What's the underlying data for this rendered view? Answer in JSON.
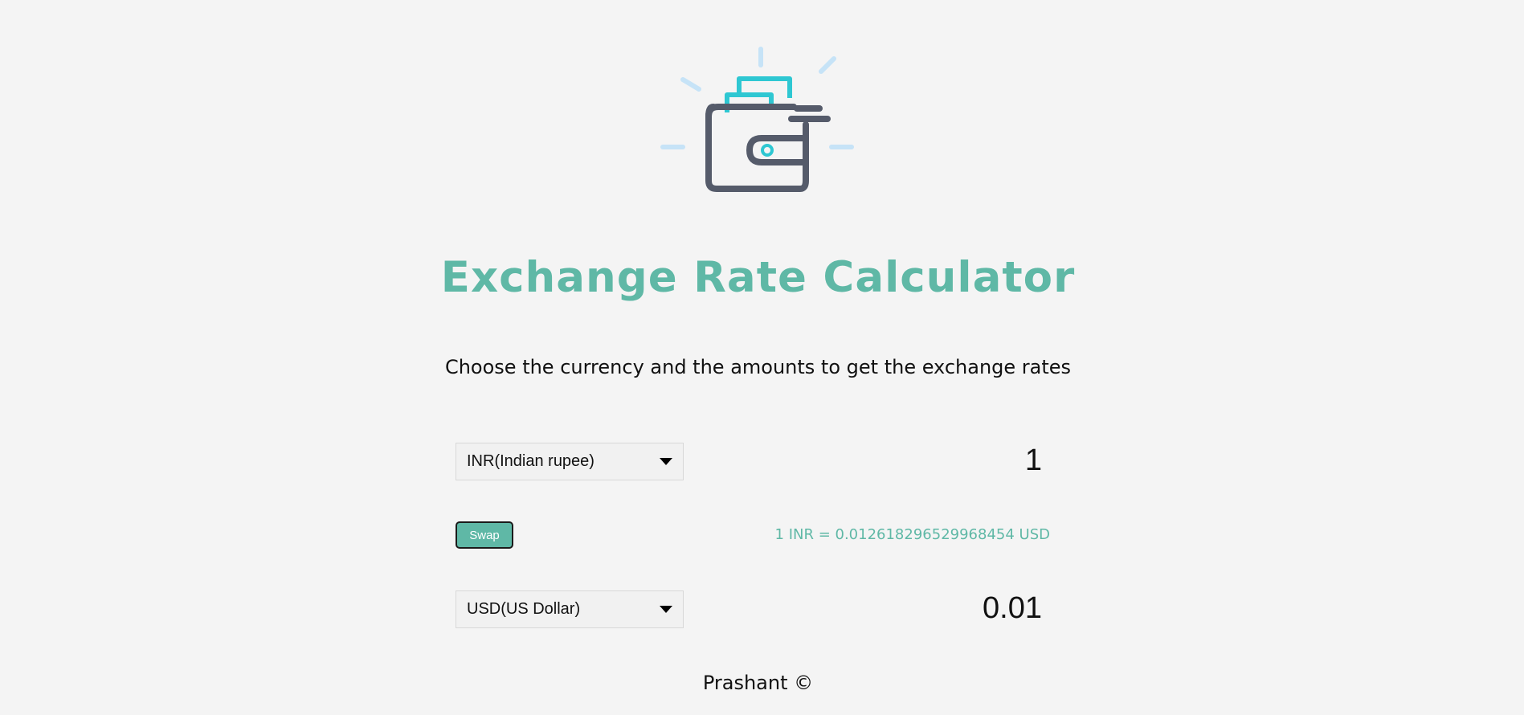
{
  "app": {
    "title": "Exchange Rate Calculator",
    "subtitle": "Choose the currency and the amounts to get the exchange rates"
  },
  "logo": {
    "icon": "wallet-icon",
    "colors": {
      "wallet": "#555b6a",
      "cards": "#2ec7d2",
      "rays": "#c6e3f7"
    }
  },
  "converter": {
    "from_currency": "INR(Indian rupee)",
    "from_amount": "1",
    "to_currency": "USD(US Dollar)",
    "to_amount": "0.01",
    "swap_label": "Swap",
    "rate_text": "1 INR = 0.012618296529968454 USD"
  },
  "footer": {
    "text": "Prashant ©"
  },
  "colors": {
    "accent": "#5fb8a6",
    "background": "#f4f4f4"
  }
}
